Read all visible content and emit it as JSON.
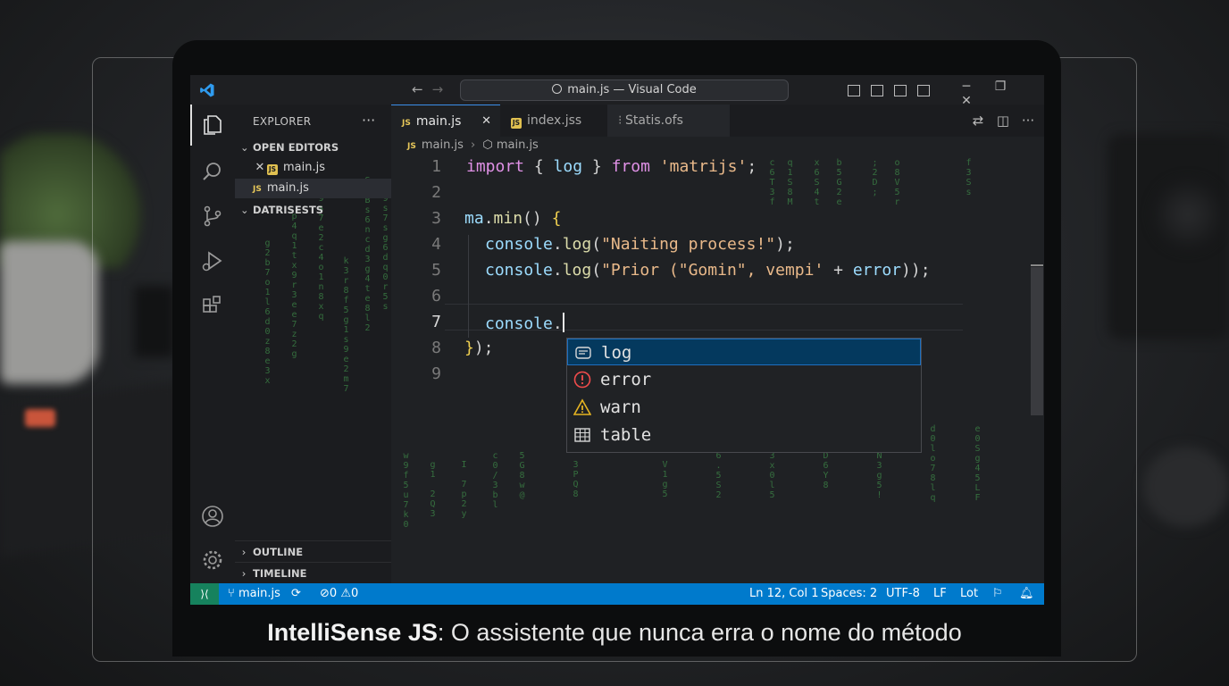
{
  "window": {
    "title": "main.js — Visual Code"
  },
  "sidebar": {
    "title": "EXPLORER",
    "more": "···",
    "open_editors": "OPEN EDITORS",
    "open_editor_items": [
      "main.js",
      "main.js"
    ],
    "datasets": "DATRISESTS",
    "outline": "OUTLINE",
    "timeline": "TIMELINE"
  },
  "tabs": [
    {
      "label": "main.js",
      "badge": "JS",
      "active": true
    },
    {
      "label": "index.jss",
      "badge": "JS",
      "active": false
    },
    {
      "label": "Statis.ofs",
      "badge": "",
      "active": false
    }
  ],
  "breadcrumb": {
    "file": "main.js",
    "symbol": "main.js"
  },
  "editor": {
    "line_numbers": [
      "1",
      "2",
      "3",
      "4",
      "5",
      "6",
      "7",
      "8",
      "9"
    ],
    "current_line": 7,
    "lines": {
      "l1": {
        "kw1": "import",
        "p1": " { ",
        "id1": "log",
        "p2": " } ",
        "kw2": "from",
        "p3": " ",
        "str": "'matrijs'",
        "p4": ";"
      },
      "l3": {
        "id": "ma",
        "p1": ".",
        "fn": "min",
        "p2": "() ",
        "brace": "{"
      },
      "l4": {
        "id": "console",
        "p1": ".",
        "fn": "log",
        "p2": "(",
        "str": "\"Naiting process!\"",
        "p3": ");"
      },
      "l5": {
        "id": "console",
        "p1": ".",
        "fn": "log",
        "p2": "(",
        "str": "\"Prior (\"Gomin\", vempi'",
        "p3": " + ",
        "id2": "error",
        "p4": "));"
      },
      "l7": {
        "id": "console",
        "p1": "."
      },
      "l8": {
        "brace": "}",
        "p1": ");"
      }
    }
  },
  "suggestions": [
    {
      "label": "log",
      "icon": "method-icon",
      "selected": true
    },
    {
      "label": "error",
      "icon": "error-icon",
      "selected": false
    },
    {
      "label": "warn",
      "icon": "warning-icon",
      "selected": false
    },
    {
      "label": "table",
      "icon": "table-icon",
      "selected": false
    }
  ],
  "statusbar": {
    "branch": "main.js",
    "errors": "0",
    "warnings": "0",
    "position": "Ln 12, Col 1",
    "spaces": "Spaces: 2",
    "encoding": "UTF-8",
    "eol": "LF",
    "language": "Lot"
  },
  "caption": {
    "bold": "IntelliSense JS",
    "rest": ": O assistente que nunca erra o nome do método"
  },
  "colors": {
    "statusbar": "#007acc",
    "accent_keyword": "#e091e6",
    "accent_string": "#e9b98a",
    "selection": "#04395e",
    "matrix_green": "#3f8f4a"
  }
}
